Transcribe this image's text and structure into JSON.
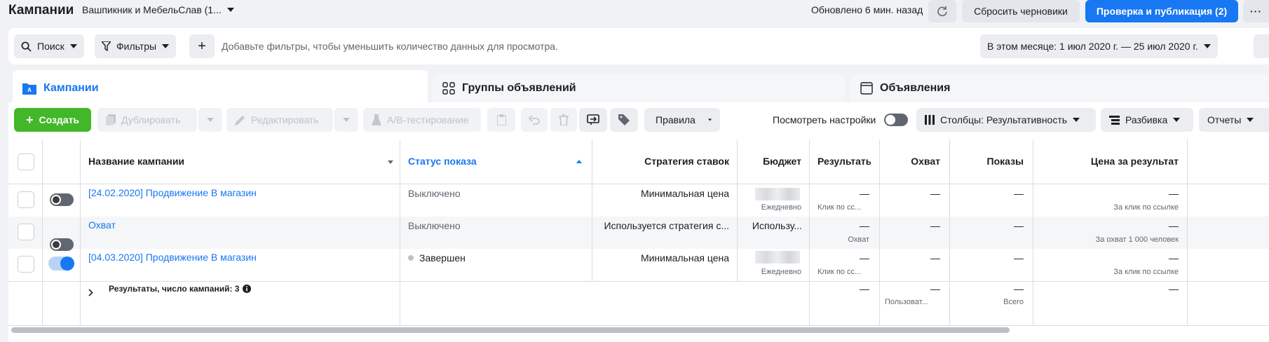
{
  "header": {
    "title": "Кампании",
    "account": "Вашпикник и МебельСлав (1...",
    "updated": "Обновлено 6 мин. назад",
    "reset_label": "Сбросить черновики",
    "publish_label": "Проверка и публикация (2)",
    "more_label": "···"
  },
  "filterbar": {
    "search_label": "Поиск",
    "filters_label": "Фильтры",
    "plus_label": "+",
    "hint": "Добавьте фильтры, чтобы уменьшить количество данных для просмотра.",
    "date_label": "В этом месяце: 1 июл 2020 г. — 25 июл 2020 г."
  },
  "tabs": [
    {
      "label": "Кампании",
      "icon": "campaign-folder-icon"
    },
    {
      "label": "Группы объявлений",
      "icon": "ad-sets-grid-icon"
    },
    {
      "label": "Объявления",
      "icon": "ad-window-icon"
    }
  ],
  "toolbar": {
    "create_label": "Создать",
    "duplicate_label": "Дублировать",
    "edit_label": "Редактировать",
    "ab_label": "A/B-тестирование",
    "rules_label": "Правила",
    "view_settings_label": "Посмотреть настройки",
    "columns_label": "Столбцы: Результативность",
    "breakdown_label": "Разбивка",
    "reports_label": "Отчеты"
  },
  "columns": {
    "name": "Название кампании",
    "status": "Статус показа",
    "strategy": "Стратегия ставок",
    "budget": "Бюджет",
    "results": "Результать",
    "reach": "Охват",
    "impressions": "Показы",
    "cost": "Цена за результат"
  },
  "rows": [
    {
      "name": "[24.02.2020] Продвижение В магазин",
      "status": "Выключено",
      "strategy": "Минимальная цена",
      "budget_sub": "Ежедневно",
      "results": "—",
      "results_sub": "Клик по сс...",
      "reach": "—",
      "impressions": "—",
      "cost": "—",
      "cost_sub": "За клик по ссылке",
      "toggle_on": false
    },
    {
      "name": "Охват",
      "status": "Выключено",
      "strategy": "Используется стратегия с...",
      "budget": "Использу...",
      "results": "—",
      "results_sub": "Охват",
      "reach": "—",
      "impressions": "—",
      "cost": "—",
      "cost_sub": "За охват 1 000 человек",
      "toggle_on": false
    },
    {
      "name": "[04.03.2020] Продвижение В магазин",
      "status": "Завершен",
      "strategy": "Минимальная цена",
      "budget_sub": "Ежедневно",
      "results": "—",
      "results_sub": "Клик по сс...",
      "reach": "—",
      "impressions": "—",
      "cost": "—",
      "cost_sub": "За клик по ссылке",
      "toggle_on": true
    }
  ],
  "summary": {
    "label": "Результаты, число кампаний: 3",
    "results": "—",
    "reach": "—",
    "reach_sub": "Пользоват...",
    "impressions": "—",
    "impressions_sub": "Всего",
    "cost": "—"
  },
  "colors": {
    "accent": "#1877f2",
    "create": "#42b72a"
  }
}
